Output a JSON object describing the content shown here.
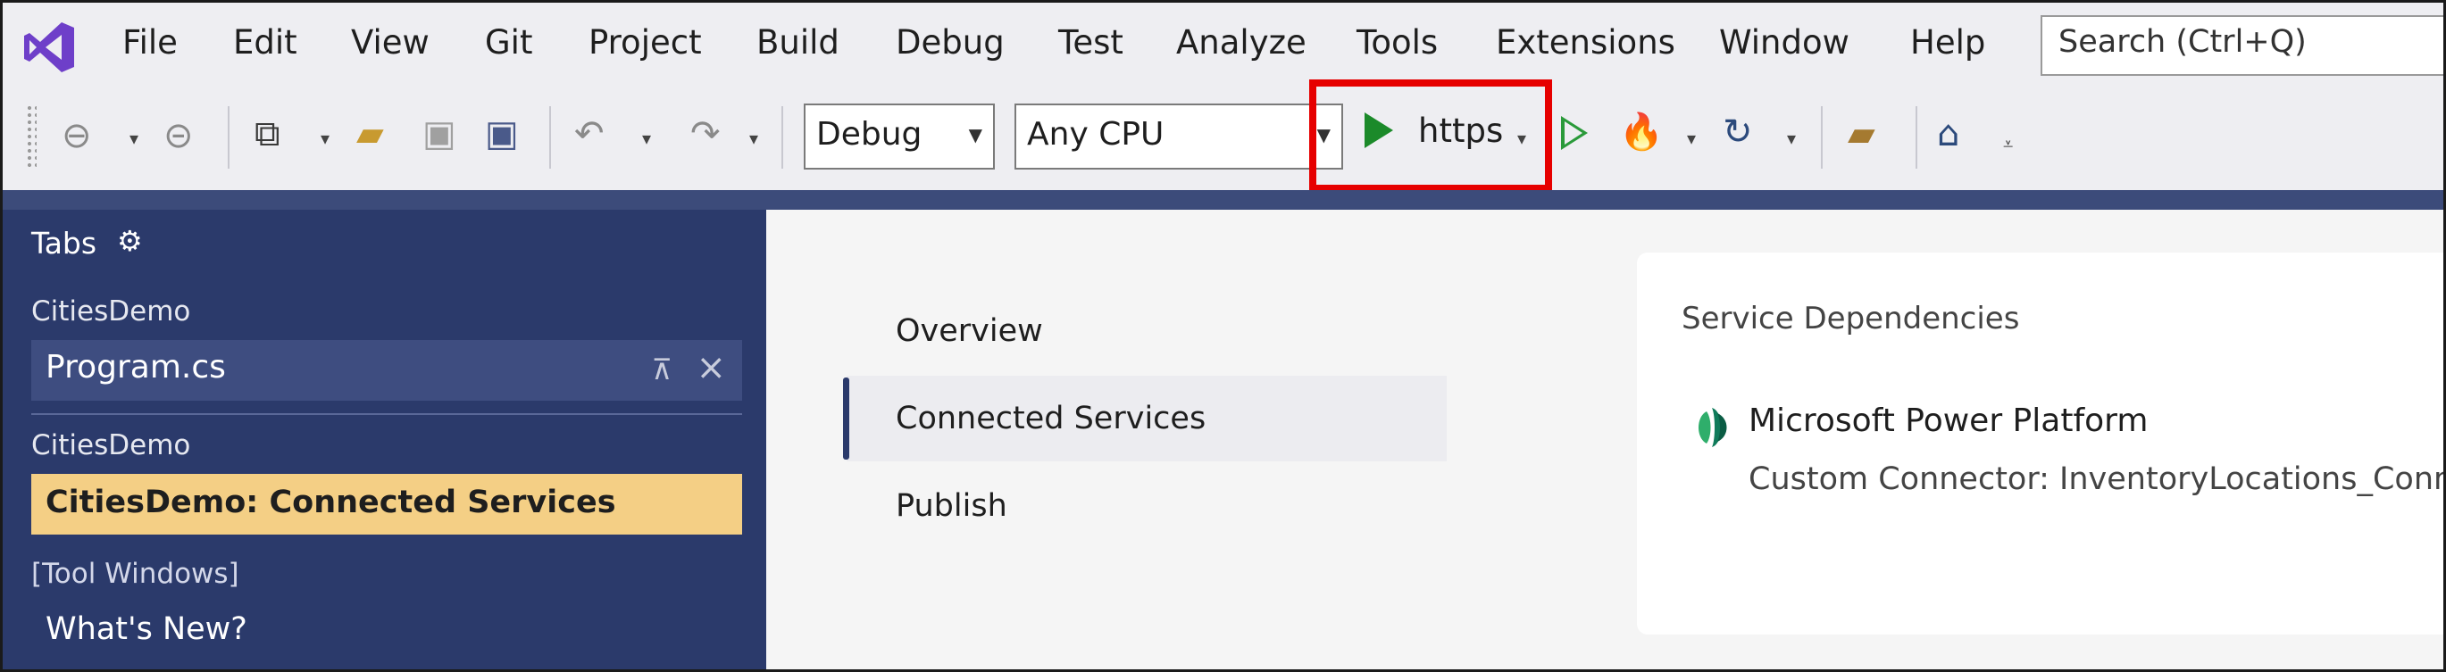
{
  "menu": {
    "items": [
      "File",
      "Edit",
      "View",
      "Git",
      "Project",
      "Build",
      "Debug",
      "Test",
      "Analyze",
      "Tools",
      "Extensions",
      "Window",
      "Help"
    ],
    "search_placeholder": "Search (Ctrl+Q)"
  },
  "toolbar": {
    "configuration": "Debug",
    "platform": "Any CPU",
    "run_profile": "https"
  },
  "sidebar": {
    "title": "Tabs",
    "groups": [
      {
        "project": "CitiesDemo",
        "file": "Program.cs"
      },
      {
        "project": "CitiesDemo",
        "file": "CitiesDemo: Connected Services"
      }
    ],
    "tool_windows_header": "[Tool Windows]",
    "tool_windows_item": "What's New?"
  },
  "main": {
    "nav": [
      "Overview",
      "Connected Services",
      "Publish"
    ],
    "card": {
      "title": "Service Dependencies",
      "service_name": "Microsoft Power Platform",
      "service_detail": "Custom Connector: InventoryLocations_Conn"
    }
  },
  "colors": {
    "accent_navy": "#2b3a6b",
    "active_tab": "#f4cf85",
    "run_green": "#1b8a2a",
    "highlight_red": "#e60000"
  }
}
